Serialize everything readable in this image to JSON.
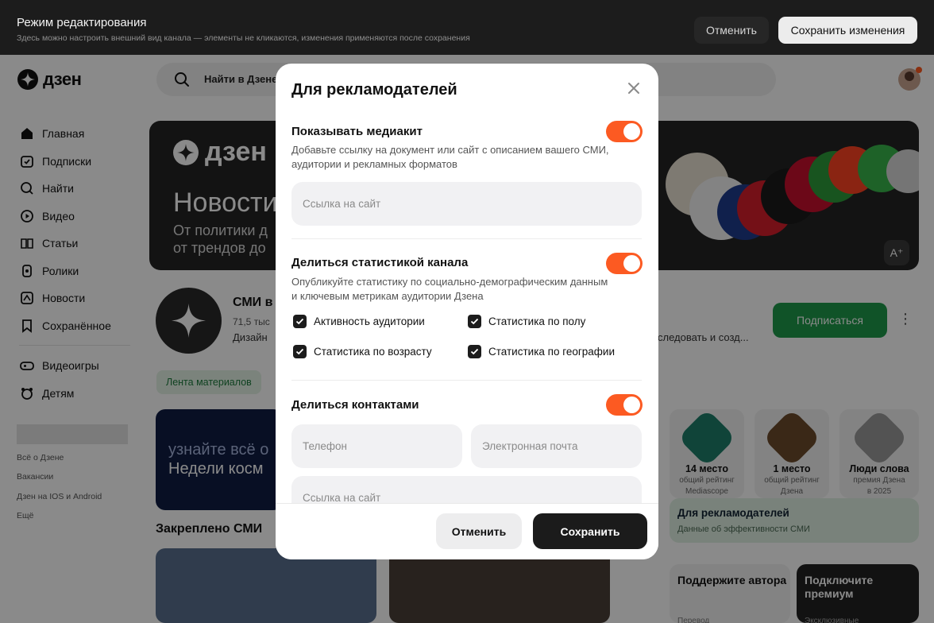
{
  "editbar": {
    "title": "Режим редактирования",
    "subtitle": "Здесь можно настроить внешний вид канала — элементы не кликаются, изменения применяются после сохранения",
    "cancel_label": "Отменить",
    "save_label": "Сохранить изменения"
  },
  "header": {
    "logo_text": "дзен",
    "search_placeholder": "Найти в Дзене"
  },
  "sidebar": {
    "items": [
      {
        "label": "Главная",
        "icon": "home-icon"
      },
      {
        "label": "Подписки",
        "icon": "subscriptions-icon"
      },
      {
        "label": "Найти",
        "icon": "search-icon"
      },
      {
        "label": "Видео",
        "icon": "video-icon"
      },
      {
        "label": "Статьи",
        "icon": "articles-icon"
      },
      {
        "label": "Ролики",
        "icon": "shorts-icon"
      },
      {
        "label": "Новости",
        "icon": "news-icon"
      },
      {
        "label": "Сохранённое",
        "icon": "bookmark-icon"
      }
    ],
    "extra_items": [
      {
        "label": "Видеоигры",
        "icon": "gamepad-icon"
      },
      {
        "label": "Детям",
        "icon": "kids-icon"
      }
    ],
    "footer_links": [
      "Всё о Дзене",
      "Вакансии",
      "Дзен на IOS и Android",
      "Ещё"
    ]
  },
  "banner": {
    "logo_text": "дзен",
    "headline": "Новости",
    "line1": "От политики д",
    "line2": "от трендов до",
    "badge": "A⁺"
  },
  "channel": {
    "name": "СМИ в",
    "subscribers": "71,5 тыс",
    "description": "Дизайн",
    "more": "следовать и созд...",
    "subscribe_label": "Подписаться",
    "feed_chip": "Лента материалов"
  },
  "promo": {
    "line1": "узнайте всё о",
    "line2": "Недели косм"
  },
  "pinned_title": "Закреплено СМИ",
  "awards": [
    {
      "number": "14",
      "title": "14 место",
      "sub1": "общий рейтинг",
      "sub2": "Mediascope"
    },
    {
      "number": "1",
      "title": "1 место",
      "sub1": "общий рейтинг",
      "sub2": "Дзена"
    },
    {
      "number": "",
      "title": "Люди слова",
      "sub1": "премия Дзена",
      "sub2": "в 2025"
    }
  ],
  "advertisers_card": {
    "title": "Для рекламодателей",
    "subtitle": "Данные об эффективности СМИ"
  },
  "support_card": {
    "title": "Поддержите автора",
    "sub": "Перевод"
  },
  "premium_card": {
    "title": "Подключите премиум",
    "sub": "Эксклюзивные"
  },
  "modal": {
    "title": "Для рекламодателей",
    "mediakit": {
      "title": "Показывать медиакит",
      "description": "Добавьте ссылку на документ или сайт с описанием вашего СМИ, аудитории и рекламных форматов",
      "enabled": true,
      "url_placeholder": "Ссылка на сайт"
    },
    "stats": {
      "title": "Делиться статистикой канала",
      "description": "Опубликуйте статистику по социально-демографическим данным и ключевым метрикам аудитории Дзена",
      "enabled": true,
      "options": [
        {
          "label": "Активность аудитории",
          "checked": true
        },
        {
          "label": "Статистика по полу",
          "checked": true
        },
        {
          "label": "Статистика по возрасту",
          "checked": true
        },
        {
          "label": "Статистика по географии",
          "checked": true
        }
      ]
    },
    "contacts": {
      "title": "Делиться контактами",
      "enabled": true,
      "phone_placeholder": "Телефон",
      "email_placeholder": "Электронная почта",
      "url_placeholder": "Ссылка на сайт"
    },
    "cancel_label": "Отменить",
    "save_label": "Сохранить"
  },
  "colors": {
    "accent": "#fc5a22",
    "dark": "#1b1b1b",
    "subscribe": "#1e9a4a"
  }
}
